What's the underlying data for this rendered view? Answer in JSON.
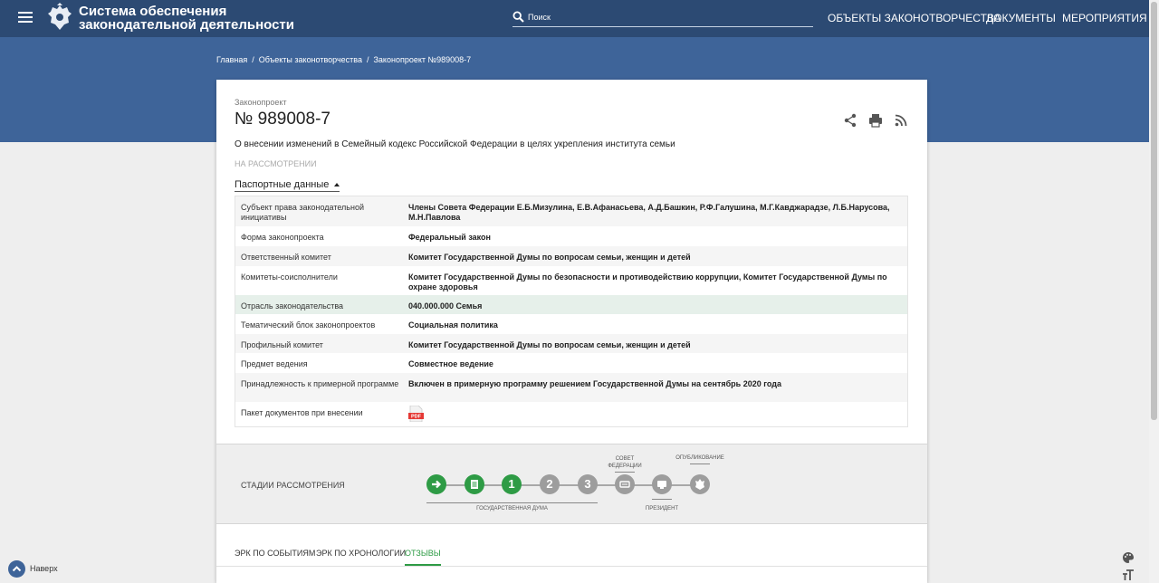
{
  "header": {
    "title_line1": "Система обеспечения",
    "title_line2": "законодательной деятельности",
    "search_placeholder": "Поиск",
    "nav": [
      "ОБЪЕКТЫ ЗАКОНОТВОРЧЕСТВА",
      "ДОКУМЕНТЫ",
      "МЕРОПРИЯТИЯ"
    ]
  },
  "breadcrumb": {
    "home": "Главная",
    "section": "Объекты законотворчества",
    "current": "Законопроект №989008-7"
  },
  "bill": {
    "type": "Законопроект",
    "number": "№ 989008-7",
    "description": "О внесении изменений в Семейный кодекс Российской Федерации в целях укрепления института семьи",
    "status": "НА РАССМОТРЕНИИ"
  },
  "passport": {
    "toggle_label": "Паспортные данные",
    "rows": [
      {
        "label": "Субъект права законодательной инициативы",
        "value": "Члены Совета Федерации Е.Б.Мизулина, Е.В.Афанасьева, А.Д.Башкин, Р.Ф.Галушина, М.Г.Кавджарадзе, Л.Б.Нарусова, М.Н.Павлова"
      },
      {
        "label": "Форма законопроекта",
        "value": "Федеральный закон"
      },
      {
        "label": "Ответственный комитет",
        "value": "Комитет Государственной Думы по вопросам семьи, женщин и детей"
      },
      {
        "label": "Комитеты-соисполнители",
        "value": "Комитет Государственной Думы по безопасности и противодействию коррупции, Комитет Государственной Думы по охране здоровья"
      },
      {
        "label": "Отрасль законодательства",
        "value": "040.000.000 Семья"
      },
      {
        "label": "Тематический блок законопроектов",
        "value": "Социальная политика"
      },
      {
        "label": "Профильный комитет",
        "value": "Комитет Государственной Думы по вопросам семьи, женщин и детей"
      },
      {
        "label": "Предмет ведения",
        "value": "Совместное ведение"
      },
      {
        "label": "Принадлежность к примерной программе",
        "value": "Включен в примерную программу решением Государственной Думы на сентябрь 2020 года"
      },
      {
        "label": "Пакет документов при внесении",
        "value": "",
        "icon": "pdf-file-icon"
      }
    ]
  },
  "stages": {
    "label": "СТАДИИ РАССМОТРЕНИЯ",
    "duma_caption": "ГОСУДАРСТВЕННАЯ ДУМА",
    "council_caption_1": "СОВЕТ",
    "council_caption_2": "ФЕДЕРАЦИИ",
    "president_caption": "ПРЕЗИДЕНТ",
    "publication_caption": "ОПУБЛИКОВАНИЕ",
    "reading_1": "1",
    "reading_2": "2",
    "reading_3": "3",
    "colors": {
      "done": "#2e9b45",
      "pending": "#9d9d9d"
    }
  },
  "tabs": [
    "ЭРК ПО СОБЫТИЯМ",
    "ЭРК ПО ХРОНОЛОГИИ",
    "ОТЗЫВЫ"
  ],
  "active_tab": "ОТЗЫВЫ",
  "back_to_top": "Наверх",
  "colors": {
    "header": "#2c4a73",
    "hero": "#3e6499",
    "accent": "#2e9b45"
  }
}
